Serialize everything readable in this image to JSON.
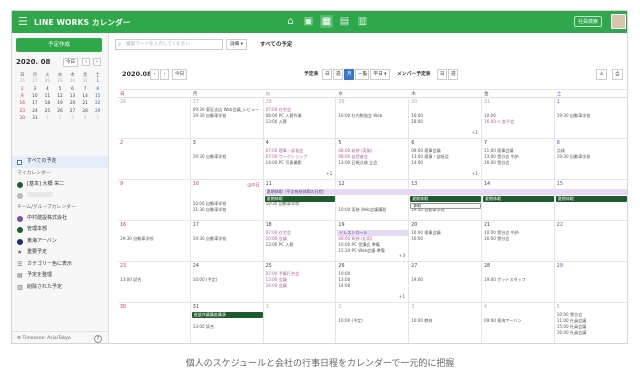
{
  "app": {
    "brand": "LINE WORKS カレンダー",
    "org_button": "社員検索",
    "apps": [
      "home",
      "chat",
      "calendar",
      "drive",
      "contacts"
    ]
  },
  "sidebar": {
    "new_button": "予定作成",
    "mini_month": "2020. 08",
    "mini_today": "今日",
    "weekdays": [
      "日",
      "月",
      "火",
      "水",
      "木",
      "金",
      "土"
    ],
    "weeks": [
      [
        "26",
        "27",
        "28",
        "29",
        "30",
        "31",
        "1"
      ],
      [
        "2",
        "3",
        "4",
        "5",
        "6",
        "7",
        "8"
      ],
      [
        "9",
        "10",
        "11",
        "12",
        "13",
        "14",
        "15"
      ],
      [
        "16",
        "17",
        "18",
        "19",
        "20",
        "21",
        "22"
      ],
      [
        "23",
        "24",
        "25",
        "26",
        "27",
        "28",
        "29"
      ],
      [
        "30",
        "31",
        "1",
        "2",
        "3",
        "4",
        "5"
      ]
    ],
    "all_schedules": "すべての予定",
    "my_calendar_label": "マイカレンダー",
    "my_items": [
      {
        "label": "[基本] 大橋 栄二",
        "color": "#1f5c2d"
      },
      {
        "label": "",
        "color": "#bbbbbb"
      }
    ],
    "team_label": "チーム/グループカレンダー",
    "team_items": [
      {
        "label": "中村建設株式会社",
        "color": "#7a4ea8"
      },
      {
        "label": "管理本部",
        "color": "#1f5c2d"
      },
      {
        "label": "東海アーバン",
        "color": "#1a2e7a"
      }
    ],
    "tools": [
      {
        "icon": "★",
        "label": "重要予定"
      },
      {
        "icon": "☰",
        "label": "カテゴリー色に表示"
      },
      {
        "icon": "▤",
        "label": "予定を整理"
      },
      {
        "icon": "▥",
        "label": "削除された予定"
      }
    ],
    "timezone": "Timezone: Asia/Tokyo"
  },
  "main": {
    "search_placeholder": "検索ワードを入力してください",
    "detail_button": "詳細 ▾",
    "view_title": "すべての予定",
    "month_label": "2020.08",
    "today_button": "今日",
    "schedule_label": "予定表",
    "view_buttons": [
      "日",
      "週",
      "月",
      "一覧",
      "平日 ▾"
    ],
    "member_label": "メンバー予定表",
    "member_buttons": [
      "日",
      "週"
    ],
    "weekdays": [
      "日",
      "月",
      "火",
      "水",
      "木",
      "金",
      "土"
    ]
  },
  "calendar": {
    "days": [
      "26",
      "27",
      "28",
      "29",
      "30",
      "31",
      "1",
      "2",
      "3",
      "4",
      "5",
      "6",
      "7",
      "8",
      "9",
      "10",
      "11",
      "12",
      "13",
      "14",
      "15",
      "16",
      "17",
      "18",
      "19",
      "20",
      "21",
      "22",
      "23",
      "24",
      "25",
      "26",
      "27",
      "28",
      "29",
      "30",
      "31",
      "1",
      "2",
      "3",
      "4",
      "5"
    ],
    "events": [
      {
        "d": 1,
        "r": 0,
        "c": "gray",
        "t": "09:30 東区支店 Web会議_レビュー"
      },
      {
        "d": 1,
        "r": 1,
        "c": "gray",
        "t": "19:30 自動車学校"
      },
      {
        "d": 2,
        "r": 0,
        "c": "pink",
        "t": "07:00 在宅会"
      },
      {
        "d": 2,
        "r": 1,
        "c": "gray",
        "t": "08:00 PC 入替作業"
      },
      {
        "d": 2,
        "r": 2,
        "c": "gray",
        "t": "13:00 入替"
      },
      {
        "d": 3,
        "r": 1,
        "c": "gray",
        "t": "16:00 社内勉強会 Web"
      },
      {
        "d": 4,
        "r": 1,
        "c": "gray",
        "t": "16:00"
      },
      {
        "d": 4,
        "r": 2,
        "c": "gray",
        "t": "18:00"
      },
      {
        "d": 5,
        "r": 1,
        "c": "gray",
        "t": "10:00"
      },
      {
        "d": 5,
        "r": 2,
        "c": "pink",
        "t": "16:00 ⊙ 女子会"
      },
      {
        "d": 6,
        "r": 1,
        "c": "gray",
        "t": "19:30 自動車学校"
      },
      {
        "d": 8,
        "r": 1,
        "c": "gray",
        "t": "19:30 自動車学校"
      },
      {
        "d": 9,
        "r": 0,
        "c": "pink",
        "t": "07:00 理事・部長会"
      },
      {
        "d": 9,
        "r": 1,
        "c": "pink",
        "t": "07:00 ワークショップ"
      },
      {
        "d": 9,
        "r": 2,
        "c": "gray",
        "t": "14:00 PC 写真撮影"
      },
      {
        "d": 10,
        "r": 0,
        "c": "pink",
        "t": "08:00 研修 (実施)"
      },
      {
        "d": 10,
        "r": 1,
        "c": "pink",
        "t": "08:00 自営者会"
      },
      {
        "d": 10,
        "r": 2,
        "c": "gray",
        "t": "13:00 日報点検 立会"
      },
      {
        "d": 11,
        "r": 0,
        "c": "gray",
        "t": "09:00 理事会議"
      },
      {
        "d": 11,
        "r": 1,
        "c": "gray",
        "t": "13:00 理事・部長会"
      },
      {
        "d": 11,
        "r": 2,
        "c": "gray",
        "t": "14:00"
      },
      {
        "d": 12,
        "r": 0,
        "c": "gray",
        "t": "11:00 理事会議"
      },
      {
        "d": 12,
        "r": 1,
        "c": "gray",
        "t": "13:00 雪谷会 中JA"
      },
      {
        "d": 12,
        "r": 2,
        "c": "gray",
        "t": "16:00 雪谷会"
      },
      {
        "d": 13,
        "r": 0,
        "c": "gray",
        "t": "点検"
      },
      {
        "d": 13,
        "r": 1,
        "c": "gray",
        "t": "19:30 自動車学校"
      },
      {
        "d": 15,
        "r": 0,
        "c": "red",
        "t": "山の日"
      },
      {
        "d": 15,
        "r": 2,
        "c": "gray",
        "t": "10:00 自動車学校"
      },
      {
        "d": 15,
        "r": 3,
        "c": "gray",
        "t": "11:30 自動車学校"
      },
      {
        "d": 16,
        "r": 2,
        "c": "gray",
        "t": "19:30 自動車学校"
      },
      {
        "d": 17,
        "r": 3,
        "c": "gray",
        "t": "10:00 実装 Web会議講習"
      },
      {
        "d": 18,
        "r": 3,
        "c": "gray",
        "t": "19:30 自動車学校"
      },
      {
        "d": 21,
        "r": 1,
        "c": "gray",
        "t": "19:30 自動車学校"
      },
      {
        "d": 22,
        "r": 1,
        "c": "gray",
        "t": "19:30 自動車学校"
      },
      {
        "d": 23,
        "r": 0,
        "c": "pink",
        "t": "07:00 在宅会"
      },
      {
        "d": 23,
        "r": 1,
        "c": "pink",
        "t": "10:00 会議"
      },
      {
        "d": 23,
        "r": 2,
        "c": "gray",
        "t": "13:00 PC 入替"
      },
      {
        "d": 24,
        "r": 1,
        "c": "pink",
        "t": "08:00 研修 (応用)"
      },
      {
        "d": 24,
        "r": 2,
        "c": "gray",
        "t": "10:00 PC 受講会 準備"
      },
      {
        "d": 24,
        "r": 3,
        "c": "gray",
        "t": "15:30 PC Web会議 準備"
      },
      {
        "d": 25,
        "r": 0,
        "c": "gray",
        "t": "10:00 理事会議"
      },
      {
        "d": 25,
        "r": 1,
        "c": "gray",
        "t": "16:00"
      },
      {
        "d": 26,
        "r": 0,
        "c": "gray",
        "t": "10:00 雪谷会 中JA"
      },
      {
        "d": 26,
        "r": 1,
        "c": "gray",
        "t": "16:00 雪谷会"
      },
      {
        "d": 28,
        "r": 1,
        "c": "gray",
        "t": "13:00  試合"
      },
      {
        "d": 29,
        "r": 1,
        "c": "gray",
        "t": "10:00  (予定)"
      },
      {
        "d": 30,
        "r": 0,
        "c": "pink",
        "t": "07:00 予算打合会"
      },
      {
        "d": 30,
        "r": 1,
        "c": "pink",
        "t": "13:00 会議"
      },
      {
        "d": 30,
        "r": 2,
        "c": "pink",
        "t": "16:00 会議"
      },
      {
        "d": 31,
        "r": 0,
        "c": "gray",
        "t": "10:00"
      },
      {
        "d": 31,
        "r": 1,
        "c": "gray",
        "t": "13:00"
      },
      {
        "d": 31,
        "r": 2,
        "c": "gray",
        "t": "14:00"
      },
      {
        "d": 32,
        "r": 1,
        "c": "gray",
        "t": "19:00"
      },
      {
        "d": 33,
        "r": 1,
        "c": "gray",
        "t": "19:00 ポットスタッフ"
      },
      {
        "d": 36,
        "r": 2,
        "c": "gray",
        "t": "13:00  試合"
      },
      {
        "d": 38,
        "r": 1,
        "c": "gray",
        "t": "10:00  (予定)"
      },
      {
        "d": 39,
        "r": 1,
        "c": "gray",
        "t": "10:00  教材"
      },
      {
        "d": 40,
        "r": 1,
        "c": "gray",
        "t": "09:00 東海アーバン"
      },
      {
        "d": 41,
        "r": 0,
        "c": "gray",
        "t": "10:00 雪谷会"
      },
      {
        "d": 41,
        "r": 1,
        "c": "gray",
        "t": "11:00 社員会議"
      },
      {
        "d": 41,
        "r": 2,
        "c": "gray",
        "t": "15:00 社員会議"
      },
      {
        "d": 41,
        "r": 3,
        "c": "gray",
        "t": "16:00 社員会議"
      }
    ],
    "more": [
      {
        "d": 4,
        "t": "+1"
      },
      {
        "d": 9,
        "t": "+1"
      },
      {
        "d": 11,
        "t": "+1"
      },
      {
        "d": 24,
        "t": "+3"
      },
      {
        "d": 31,
        "t": "+1"
      }
    ],
    "bars": [
      {
        "week": 2,
        "from": 2,
        "to": 6,
        "row": 0,
        "style": "lav",
        "t": "夏期休暇（平次有給休暇の日程）"
      },
      {
        "week": 2,
        "from": 2,
        "to": 2,
        "row": 1,
        "style": "dark",
        "t": "夏期休暇"
      },
      {
        "week": 2,
        "from": 4,
        "to": 4,
        "row": 1,
        "style": "dark",
        "t": "夏期休暇"
      },
      {
        "week": 2,
        "from": 5,
        "to": 5,
        "row": 1,
        "style": "dark",
        "t": "夏期休暇"
      },
      {
        "week": 2,
        "from": 6,
        "to": 6,
        "row": 1,
        "style": "dark",
        "t": "夏期休暇"
      },
      {
        "week": 2,
        "from": 4,
        "to": 4,
        "row": 2,
        "style": "outline",
        "t": "休暇"
      },
      {
        "week": 3,
        "from": 3,
        "to": 3,
        "row": 0,
        "style": "lav",
        "t": "ドレストロール"
      },
      {
        "week": 5,
        "from": 1,
        "to": 1,
        "row": 0,
        "style": "dark",
        "t": "座談共議講座講演"
      }
    ]
  },
  "caption": "個人のスケジュールと会社の行事日程をカレンダーで一元的に把握"
}
